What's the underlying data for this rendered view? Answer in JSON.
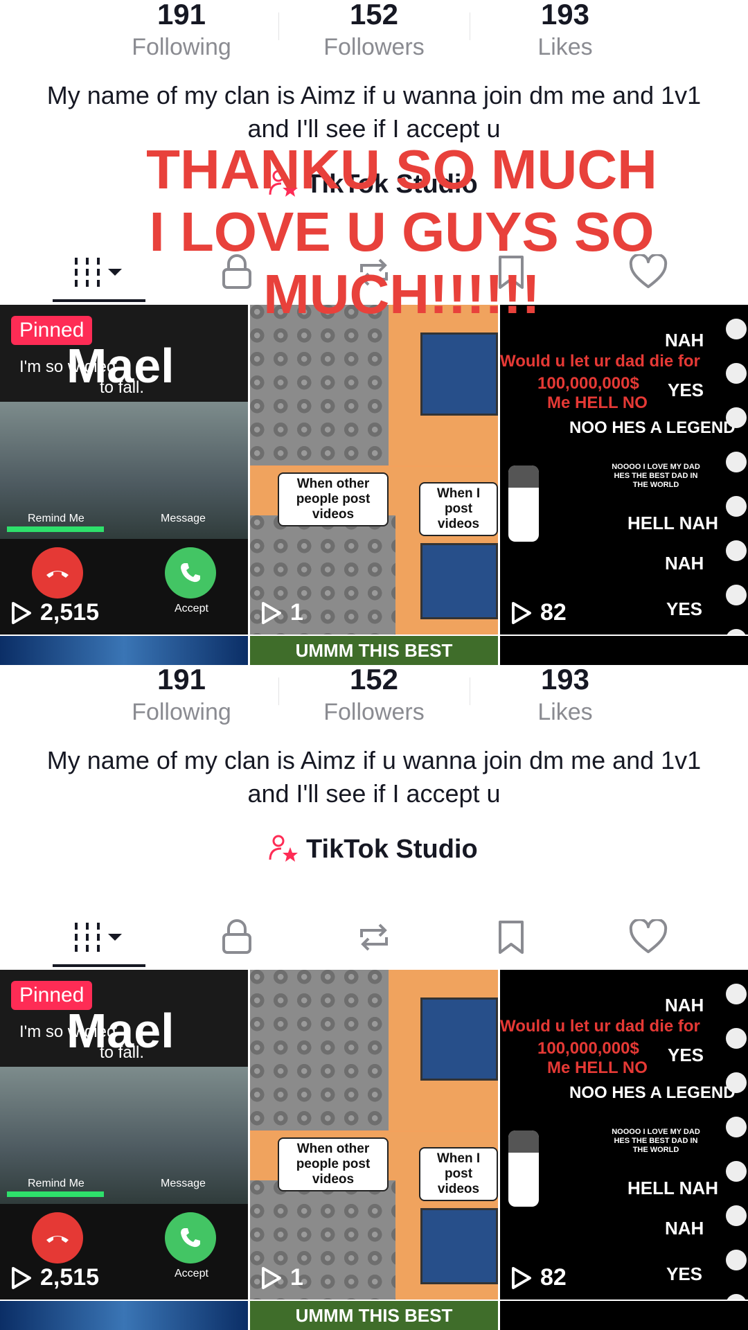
{
  "profile": {
    "stats": [
      {
        "value": "191",
        "label": "Following"
      },
      {
        "value": "152",
        "label": "Followers"
      },
      {
        "value": "193",
        "label": "Likes"
      }
    ],
    "bio": "My name of my clan is Aimz if u wanna join dm me and 1v1 and I'll see if I accept u",
    "studio_label": "TikTok Studio"
  },
  "tabs": [
    "videos-icon",
    "lock-icon",
    "repost-icon",
    "bookmark-icon",
    "heart-icon"
  ],
  "videos": [
    {
      "badge": "Pinned",
      "overlay_title": "Mael",
      "caption": "I'm so                     w died",
      "caption_sub": "to fall.",
      "remind": "Remind Me",
      "message": "Message",
      "accept": "Accept",
      "views": "2,515"
    },
    {
      "bubble_left": "When other people post videos",
      "bubble_right": "When I post videos",
      "views": "1"
    },
    {
      "lines": [
        "NAH",
        "Would u let ur dad die for",
        "100,000,000$",
        "Me HELL NO",
        "YES",
        "NOO HES A LEGEND",
        "NOOOO I LOVE MY DAD HES THE BEST DAD IN THE WORLD",
        "HELL NAH",
        "NAH",
        "YES"
      ],
      "views": "82"
    }
  ],
  "strips": [
    "",
    "UMMM THIS BEST",
    ""
  ],
  "overlay_text": "THANKU SO MUCH I LOVE U GUYS SO MUCH!!!!!!",
  "colors": {
    "accent": "#fe2c55",
    "overlay": "#e8413b",
    "decline": "#e53935",
    "accept": "#43c564"
  }
}
